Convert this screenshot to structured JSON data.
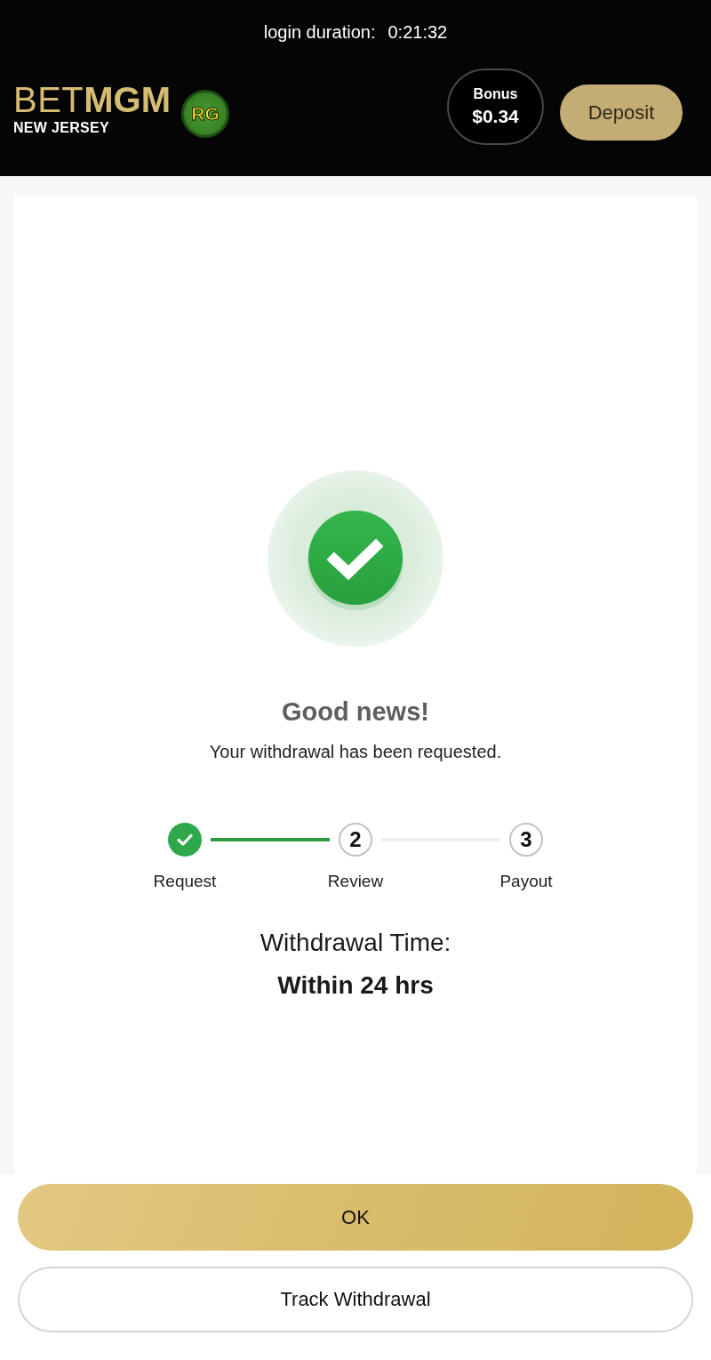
{
  "header": {
    "session": {
      "label": "login duration:",
      "value": "0:21:32"
    },
    "logo": {
      "name": "BET**MGM**",
      "region": "NEW JERSEY"
    },
    "rg_badge": "RG",
    "bonus": {
      "label": "Bonus",
      "amount": "$0.34"
    },
    "deposit_button": "Deposit"
  },
  "confirmation": {
    "title": "Good news!",
    "message": "Your withdrawal has been requested."
  },
  "steps": [
    {
      "label": "Request",
      "completed": true
    },
    {
      "number": "2",
      "label": "Review",
      "completed": false
    },
    {
      "number": "3",
      "label": "Payout",
      "completed": false
    }
  ],
  "withdrawal_time": {
    "label": "Withdrawal Time:",
    "value": "Within 24 hrs"
  },
  "actions": [
    {
      "kind": "primary",
      "label": "OK"
    },
    {
      "kind": "secondary",
      "label": "Track Withdrawal"
    }
  ]
}
